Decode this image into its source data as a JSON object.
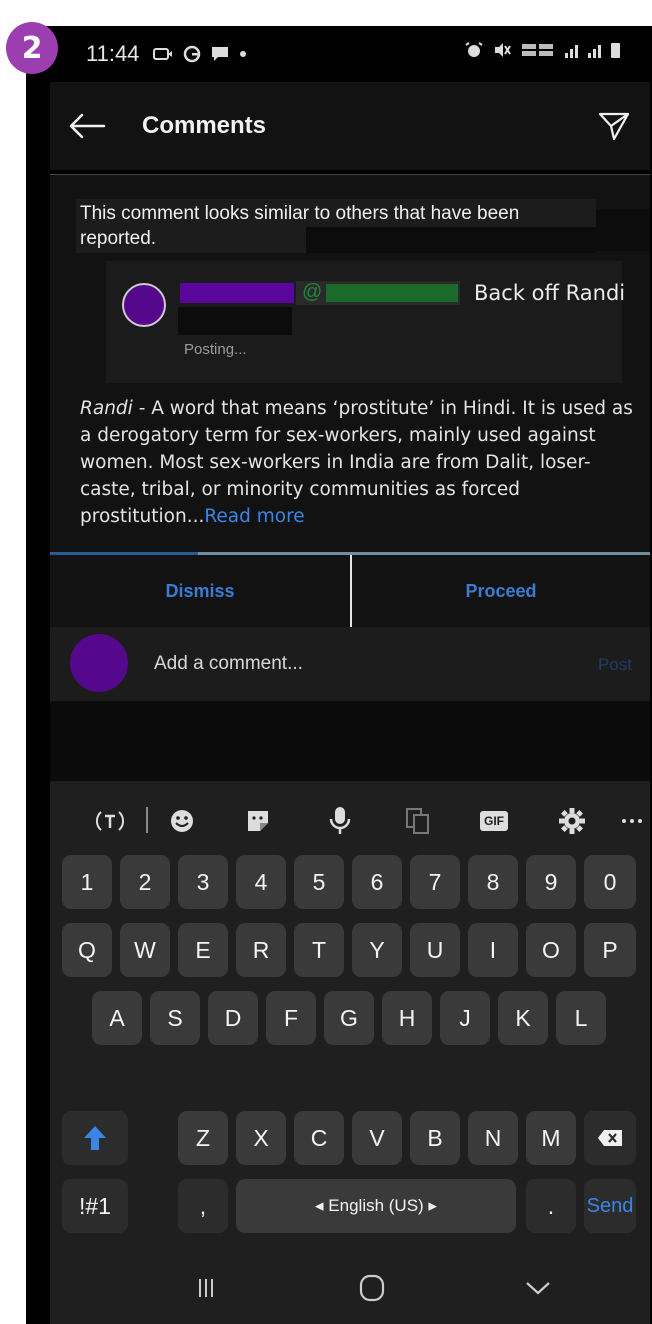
{
  "badge": "2",
  "status_bar": {
    "time": "11:44",
    "left_icons": [
      "message-icon",
      "g-icon",
      "chat-icon",
      "dot-icon"
    ],
    "right_icons": [
      "alarm-icon",
      "mute-icon",
      "volte-lte-icon",
      "signal-icon",
      "battery-icon"
    ]
  },
  "app_bar": {
    "title": "Comments"
  },
  "warning": {
    "text": "This comment looks similar to others that have been reported."
  },
  "preview": {
    "mention_at": "@",
    "reply_text": "Back off Randi",
    "status": "Posting..."
  },
  "definition": {
    "term": "Randi",
    "separator": " - ",
    "body": "A word that means ‘prostitute’ in Hindi. It is used as a derogatory term for sex-workers, mainly used against women. Most sex-workers in India are from Dalit, loser-caste, tribal, or minority communities as forced prostitution...",
    "read_more": "Read more"
  },
  "actions": {
    "dismiss": "Dismiss",
    "proceed": "Proceed"
  },
  "composer": {
    "placeholder": "Add a comment...",
    "post": "Post"
  },
  "keyboard": {
    "number_row": [
      "1",
      "2",
      "3",
      "4",
      "5",
      "6",
      "7",
      "8",
      "9",
      "0"
    ],
    "row1": [
      "Q",
      "W",
      "E",
      "R",
      "T",
      "Y",
      "U",
      "I",
      "O",
      "P"
    ],
    "row2": [
      "A",
      "S",
      "D",
      "F",
      "G",
      "H",
      "J",
      "K",
      "L"
    ],
    "row3": [
      "Z",
      "X",
      "C",
      "V",
      "B",
      "N",
      "M"
    ],
    "symbols": "!#1",
    "comma": ",",
    "space": "◂  English (US)  ▸",
    "period": ".",
    "send": "Send",
    "toolbar_gif": "GIF"
  },
  "colors": {
    "accent": "#3a86e8",
    "avatar": "#55088c",
    "badge": "#9b3fb0",
    "mention": "#1f8a3a"
  }
}
